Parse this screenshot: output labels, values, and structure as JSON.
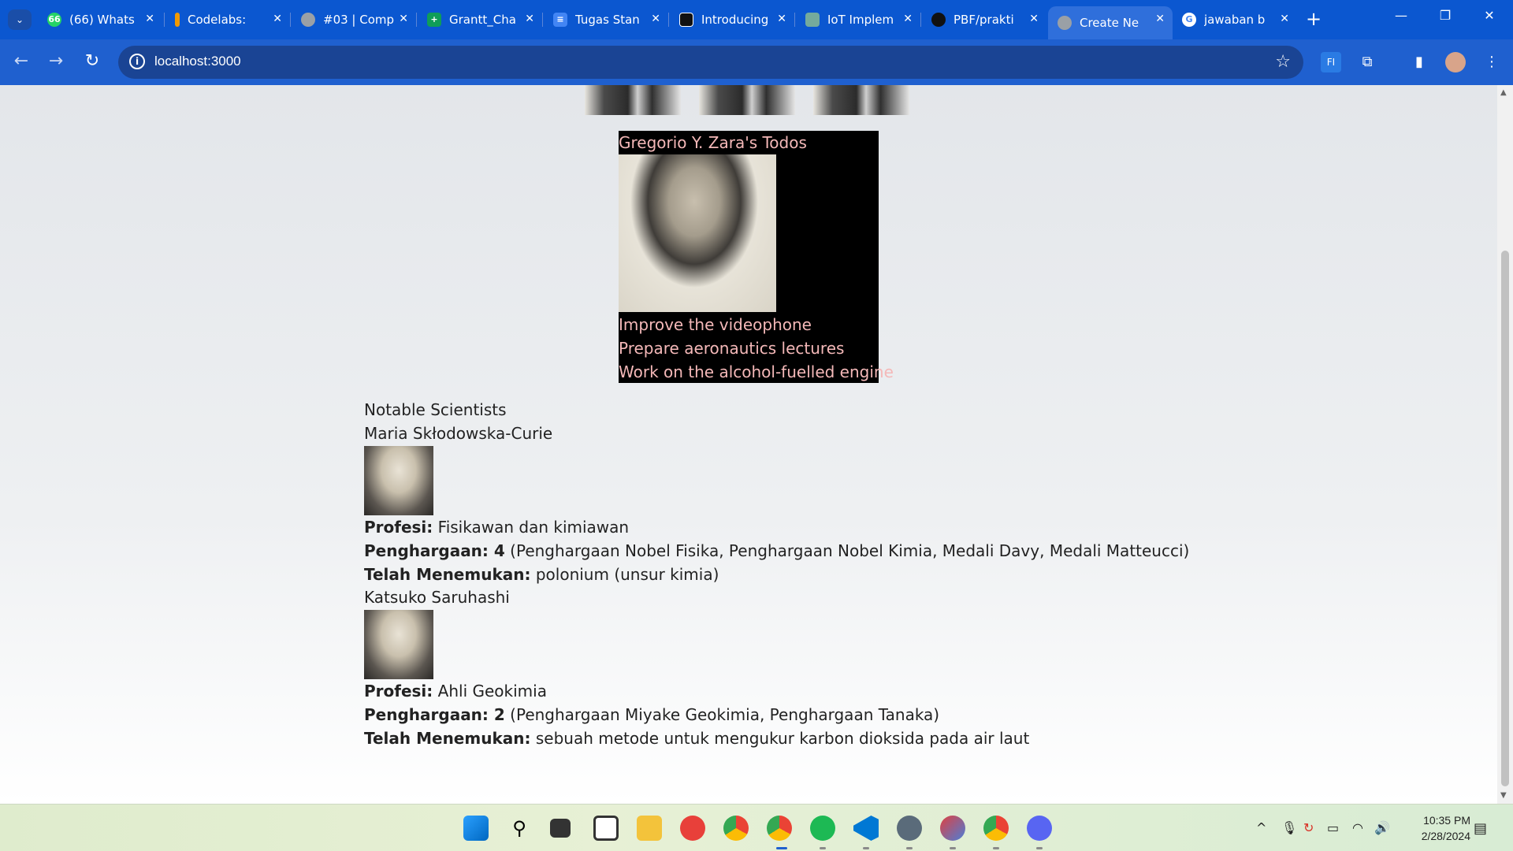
{
  "browser": {
    "tabs": [
      {
        "label": "(66) Whats",
        "favicon_badge": "66",
        "favicon_color": "#25d366"
      },
      {
        "label": "Codelabs:",
        "favicon_badge": "",
        "favicon_color": "#f29900"
      },
      {
        "label": "#03 | Comp",
        "favicon_badge": "",
        "favicon_color": "#9aa0a6"
      },
      {
        "label": "Grantt_Cha",
        "favicon_badge": "+",
        "favicon_color": "#0f9d58"
      },
      {
        "label": "Tugas Stan",
        "favicon_badge": "≡",
        "favicon_color": "#4285f4"
      },
      {
        "label": "Introducing",
        "favicon_badge": "",
        "favicon_color": "#111111"
      },
      {
        "label": "IoT Implem",
        "favicon_badge": "",
        "favicon_color": "#74aa9c"
      },
      {
        "label": "PBF/prakti",
        "favicon_badge": "",
        "favicon_color": "#111111"
      },
      {
        "label": "Create Ne",
        "favicon_badge": "",
        "favicon_color": "#9aa0a6"
      },
      {
        "label": "jawaban b",
        "favicon_badge": "G",
        "favicon_color": "#ffffff"
      }
    ],
    "active_tab_index": 8,
    "url": "localhost:3000"
  },
  "page": {
    "todo_card": {
      "title": "Gregorio Y. Zara's Todos",
      "items": [
        "Improve the videophone",
        "Prepare aeronautics lectures",
        "Work on the alcohol-fuelled engine"
      ],
      "text_color": "#f4b8b8",
      "background": "#000000"
    },
    "scientists_heading": "Notable Scientists",
    "scientists": [
      {
        "name": "Maria Skłodowska-Curie",
        "profession_label": "Profesi:",
        "profession": "Fisikawan dan kimiawan",
        "awards_label": "Penghargaan: 4",
        "awards": "(Penghargaan Nobel Fisika, Penghargaan Nobel Kimia, Medali Davy, Medali Matteucci)",
        "discovered_label": "Telah Menemukan:",
        "discovered": "polonium (unsur kimia)"
      },
      {
        "name": "Katsuko Saruhashi",
        "profession_label": "Profesi:",
        "profession": "Ahli Geokimia",
        "awards_label": "Penghargaan: 2",
        "awards": "(Penghargaan Miyake Geokimia, Penghargaan Tanaka)",
        "discovered_label": "Telah Menemukan:",
        "discovered": "sebuah metode untuk mengukur karbon dioksida pada air laut"
      }
    ]
  },
  "taskbar": {
    "apps": [
      "windows-start",
      "search",
      "task-view",
      "widgets",
      "file-explorer",
      "wps-office",
      "chrome",
      "chrome-profile",
      "spotify",
      "vscode",
      "settings",
      "snipping-tool",
      "chrome-alt",
      "discord"
    ],
    "clock_time": "10:35 PM",
    "clock_date": "2/28/2024"
  }
}
